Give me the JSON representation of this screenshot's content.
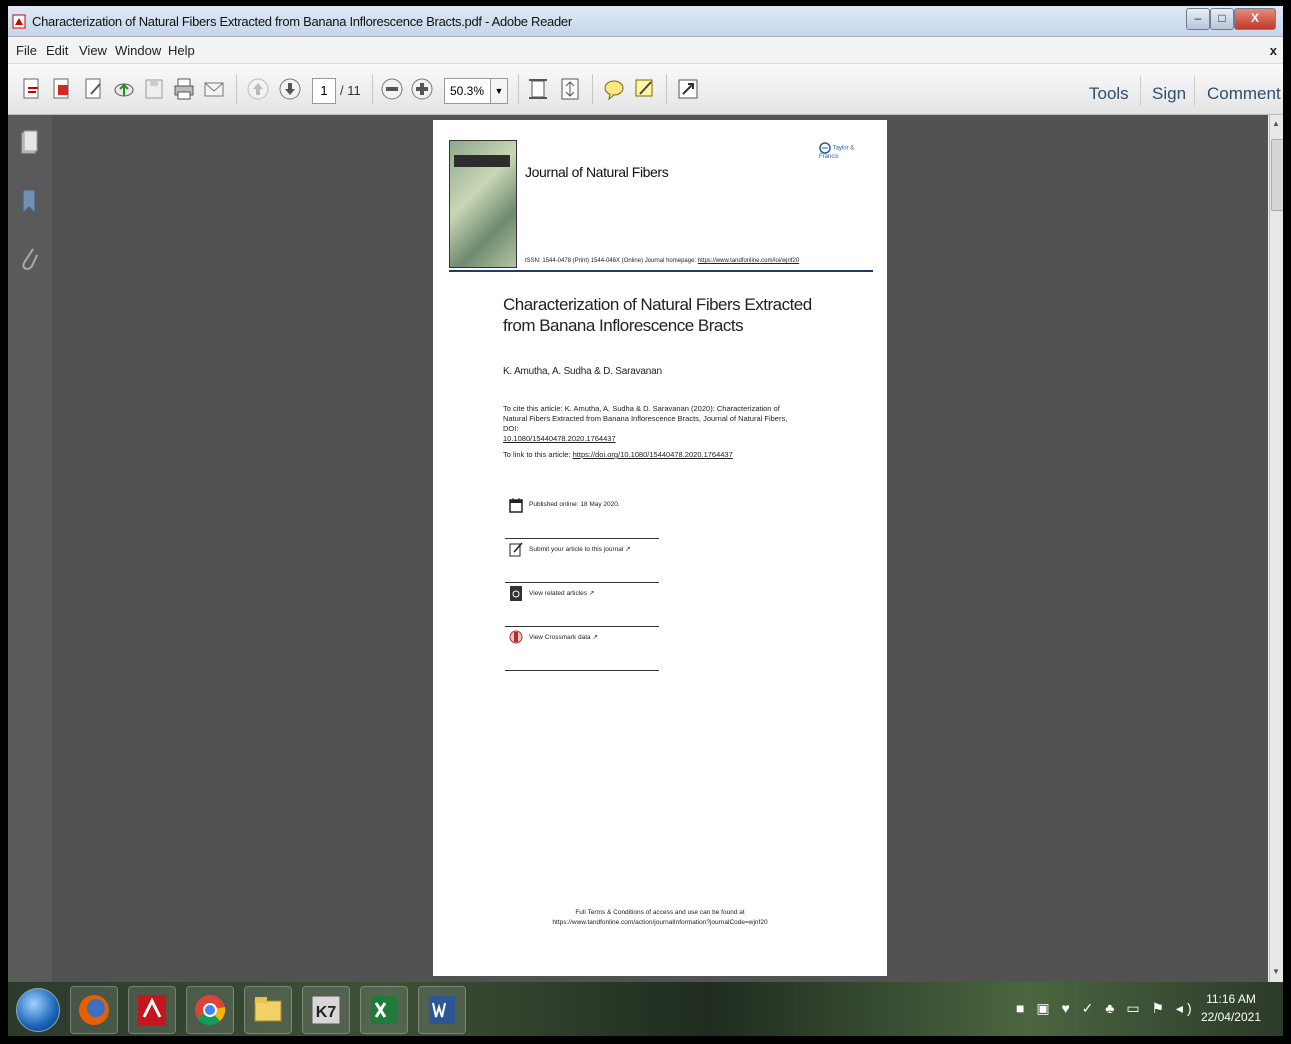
{
  "window": {
    "title": "Characterization of Natural Fibers Extracted from Banana Inflorescence Bracts.pdf - Adobe Reader",
    "controls": {
      "minimize": "–",
      "maximize": "□",
      "close": "X"
    }
  },
  "menu": {
    "items": [
      "File",
      "Edit",
      "View",
      "Window",
      "Help"
    ],
    "close_glyph": "x"
  },
  "toolbar": {
    "page_current": "1",
    "page_total": "/ 11",
    "zoom": "50.3%",
    "zoom_dropdown": "▼",
    "right_links": [
      "Tools",
      "Sign",
      "Comment"
    ]
  },
  "document": {
    "journal_title": "Journal of Natural Fibers",
    "publisher_logo_text": "Taylor & Francis",
    "issn_line": "ISSN: 1544-0478 (Print) 1544-046X (Online) Journal homepage:",
    "issn_url": "https://www.tandfonline.com/loi/wjnf20",
    "article_title": "Characterization of Natural Fibers Extracted from Banana Inflorescence Bracts",
    "authors": "K. Amutha, A. Sudha & D. Saravanan",
    "citation_text": "To cite this article: K. Amutha, A. Sudha & D. Saravanan (2020): Characterization of Natural Fibers Extracted from Banana Inflorescence Bracts, Journal of Natural Fibers, DOI:",
    "citation_doi": "10.1080/15440478.2020.1764437",
    "link_label": "To link to this article:",
    "link_url": "https://doi.org/10.1080/15440478.2020.1764437",
    "items": [
      {
        "icon": "calendar-icon",
        "text": "Published online: 18 May 2020."
      },
      {
        "icon": "edit-icon",
        "text": "Submit your article to this journal ↗"
      },
      {
        "icon": "document-search-icon",
        "text": "View related articles ↗"
      },
      {
        "icon": "crossmark-icon",
        "text": "View Crossmark data ↗"
      }
    ],
    "footer_line1": "Full Terms & Conditions of access and use can be found at",
    "footer_line2": "https://www.tandfonline.com/action/journalInformation?journalCode=wjnf20"
  },
  "taskbar": {
    "apps": [
      "firefox-icon",
      "acrobat-icon",
      "chrome-icon",
      "file-explorer-icon",
      "k7-icon",
      "excel-icon",
      "word-icon"
    ],
    "k7_label": "K7",
    "tray_icons": "■ ▣ ♥ ✓ ♣ ▭ ⚑ ◂)",
    "time": "11:16 AM",
    "date": "22/04/2021"
  },
  "colors": {
    "viewer_bg": "#525252",
    "accent": "#1e3a6e",
    "link": "#2f4f6f"
  }
}
